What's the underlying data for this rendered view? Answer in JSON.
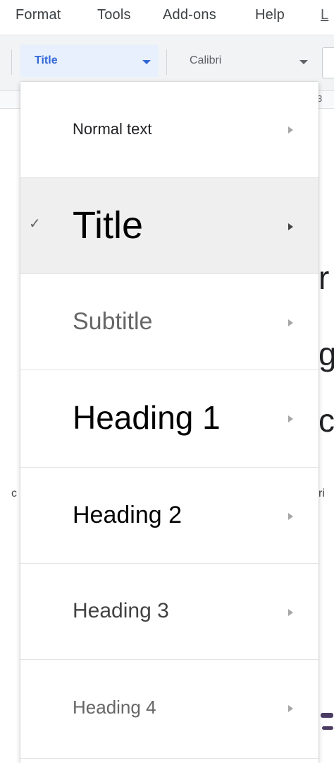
{
  "menubar": {
    "items": [
      "Format",
      "Tools",
      "Add-ons",
      "Help"
    ],
    "partial_item": "L"
  },
  "toolbar": {
    "style_value": "Title",
    "font_value": "Calibri"
  },
  "ruler": {
    "partial_number": "3"
  },
  "document": {
    "fragments": [
      "r",
      "g",
      "c",
      "c",
      "ri"
    ]
  },
  "style_menu": {
    "selected_index": 1,
    "check_glyph": "✓",
    "items": [
      {
        "label": "Normal text",
        "color": "#202124"
      },
      {
        "label": "Title",
        "color": "#000000"
      },
      {
        "label": "Subtitle",
        "color": "#666666"
      },
      {
        "label": "Heading 1",
        "color": "#000000"
      },
      {
        "label": "Heading 2",
        "color": "#000000"
      },
      {
        "label": "Heading 3",
        "color": "#434343"
      },
      {
        "label": "Heading 4",
        "color": "#666666"
      }
    ]
  },
  "colors": {
    "accent": "#3367d6",
    "accent_bg": "#e8f0fe",
    "menu_hover": "#efefef"
  }
}
